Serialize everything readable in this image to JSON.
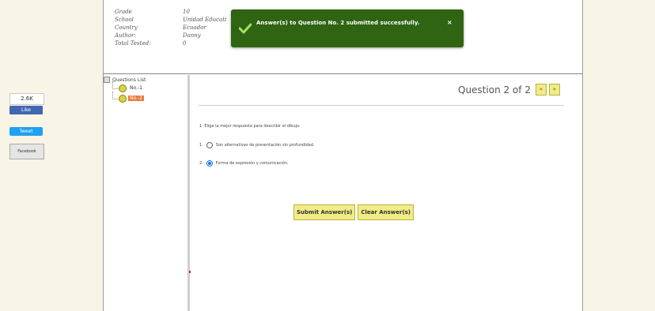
{
  "social": {
    "fb_count": "2.6K",
    "fb_like": "Like",
    "tweet": "Tweet",
    "facebook": "Facebook"
  },
  "info": {
    "rows": [
      {
        "label": "Grade",
        "value": "10"
      },
      {
        "label": "School",
        "value": "Unidad Educati"
      },
      {
        "label": "Country",
        "value": "Ecuador"
      },
      {
        "label": "Author:",
        "value": "Danny"
      },
      {
        "label": "Total Tested:",
        "value": "0"
      }
    ]
  },
  "toast": {
    "message": "Answer(s) to Question No. 2 submitted successfully.",
    "close": "×",
    "color": "#2e6412"
  },
  "tree": {
    "root": "Questions List",
    "items": [
      "No.-1",
      "No.-2"
    ],
    "selected_color": "#e87c3e"
  },
  "question": {
    "header": "Question 2 of 2",
    "prev": "«",
    "next": "»",
    "text": "1. Elige la mejor respuesta para describir el dibujo.",
    "options": [
      {
        "num": "1.",
        "text": "Son alternativas de presentación sin profundidad.",
        "selected": false
      },
      {
        "num": "2.",
        "text": "Forma de expresión y comunicación.",
        "selected": true
      }
    ]
  },
  "actions": {
    "submit": "Submit Answer(s)",
    "clear": "Clear Answer(s)"
  }
}
